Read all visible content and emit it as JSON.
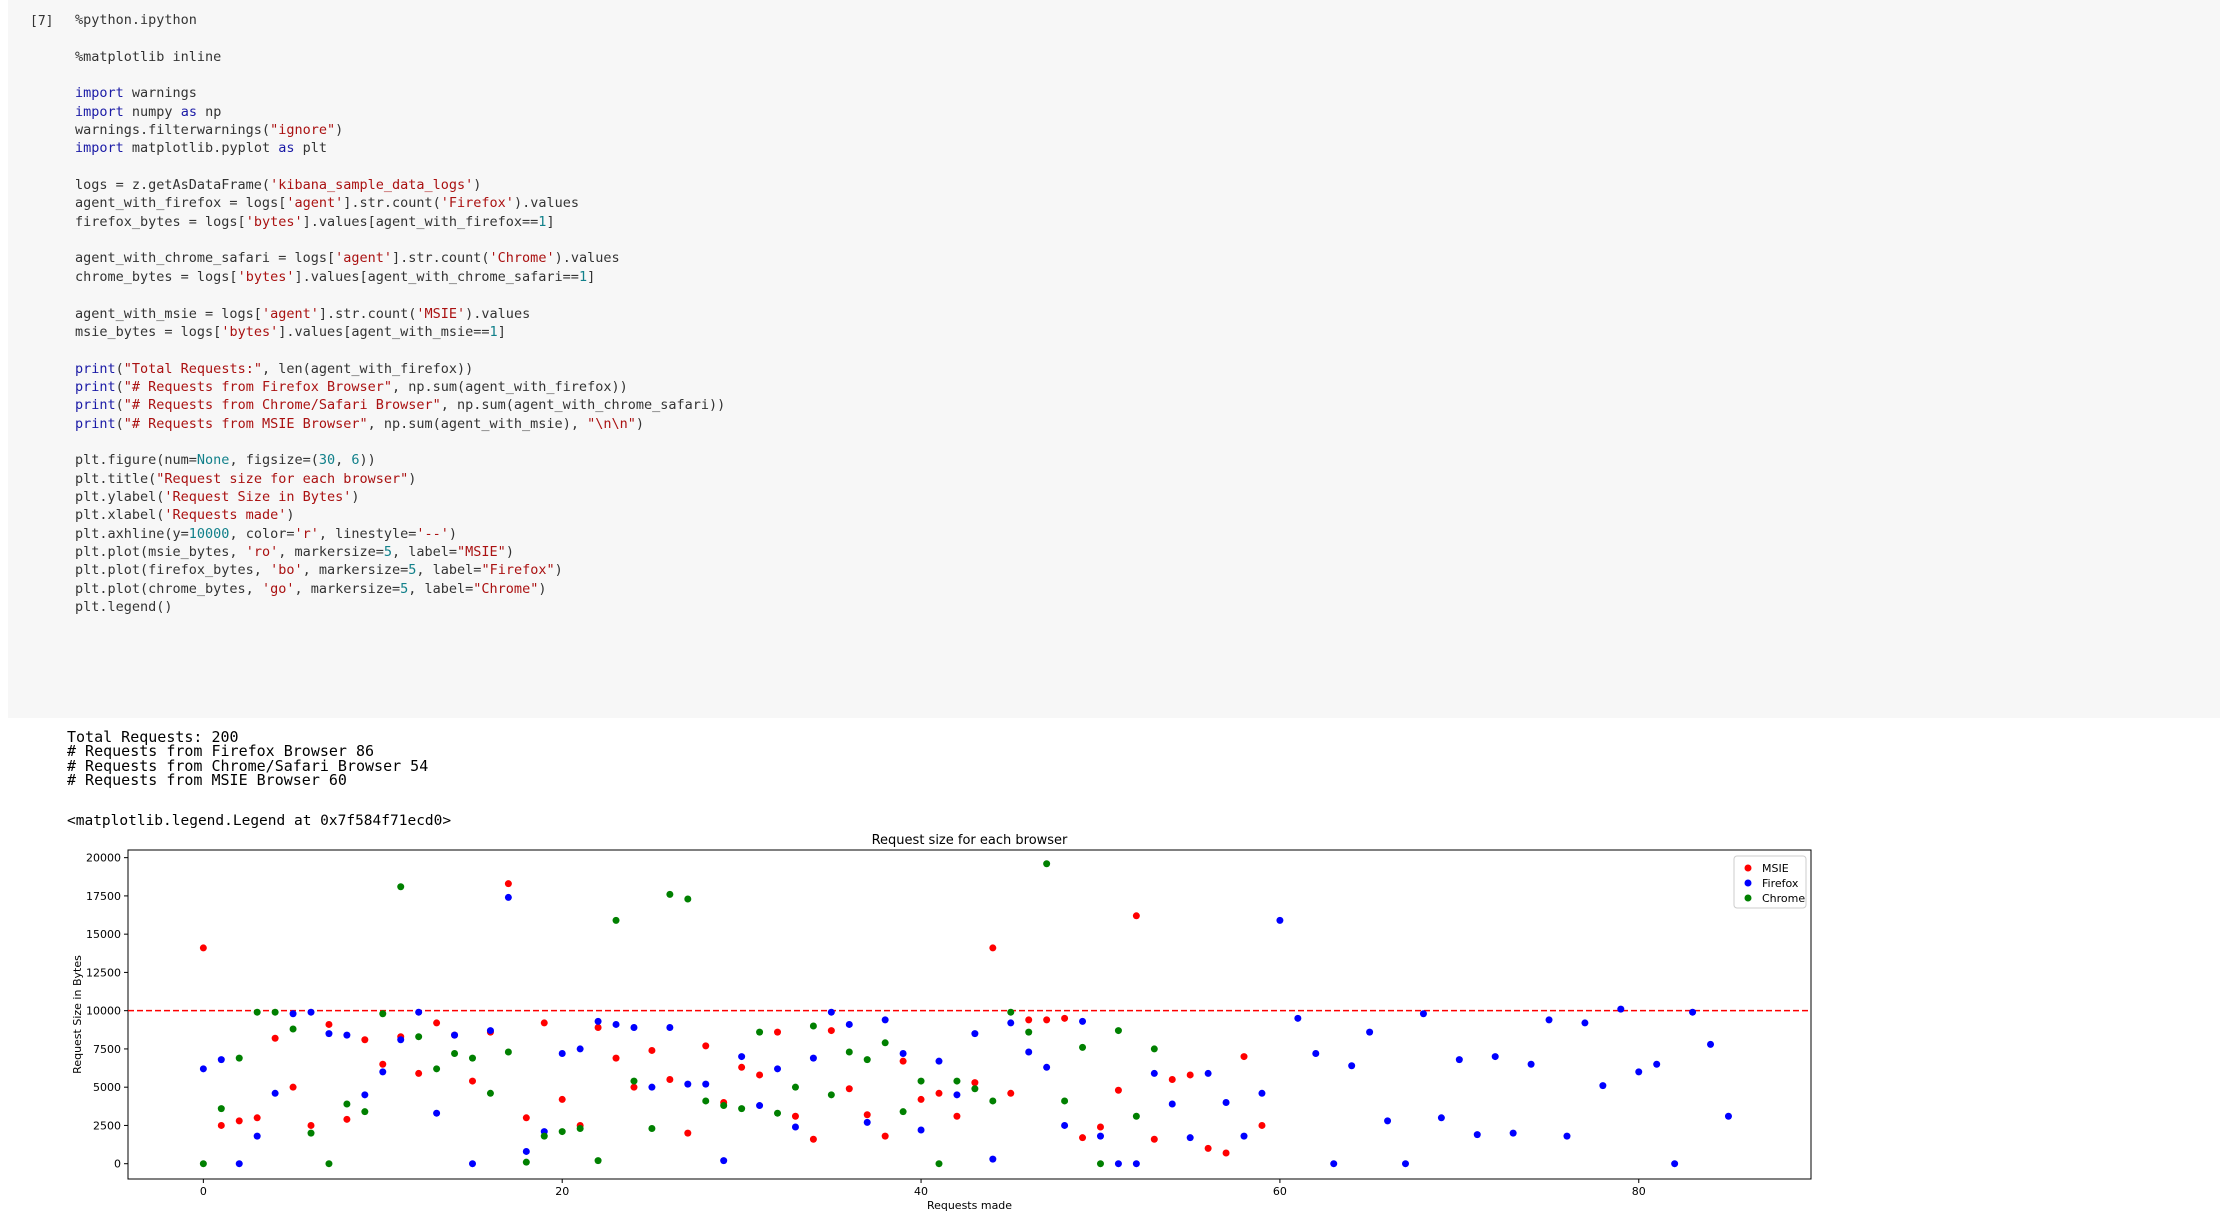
{
  "cell": {
    "prompt": "[7]",
    "code_lines": [
      [
        {
          "t": "%python.ipython",
          "c": ""
        }
      ],
      [],
      [
        {
          "t": "%matplotlib inline",
          "c": ""
        }
      ],
      [],
      [
        {
          "t": "import",
          "c": "kw"
        },
        {
          "t": " warnings",
          "c": ""
        }
      ],
      [
        {
          "t": "import",
          "c": "kw"
        },
        {
          "t": " numpy ",
          "c": ""
        },
        {
          "t": "as",
          "c": "kw"
        },
        {
          "t": " np",
          "c": ""
        }
      ],
      [
        {
          "t": "warnings.filterwarnings(",
          "c": ""
        },
        {
          "t": "\"ignore\"",
          "c": "str"
        },
        {
          "t": ")",
          "c": ""
        }
      ],
      [
        {
          "t": "import",
          "c": "kw"
        },
        {
          "t": " matplotlib.pyplot ",
          "c": ""
        },
        {
          "t": "as",
          "c": "kw"
        },
        {
          "t": " plt",
          "c": ""
        }
      ],
      [],
      [
        {
          "t": "logs = z.getAsDataFrame(",
          "c": ""
        },
        {
          "t": "'kibana_sample_data_logs'",
          "c": "str"
        },
        {
          "t": ")",
          "c": ""
        }
      ],
      [
        {
          "t": "agent_with_firefox = logs[",
          "c": ""
        },
        {
          "t": "'agent'",
          "c": "str"
        },
        {
          "t": "].str.count(",
          "c": ""
        },
        {
          "t": "'Firefox'",
          "c": "str"
        },
        {
          "t": ").values",
          "c": ""
        }
      ],
      [
        {
          "t": "firefox_bytes = logs[",
          "c": ""
        },
        {
          "t": "'bytes'",
          "c": "str"
        },
        {
          "t": "].values[agent_with_firefox==",
          "c": ""
        },
        {
          "t": "1",
          "c": "num"
        },
        {
          "t": "]",
          "c": ""
        }
      ],
      [],
      [
        {
          "t": "agent_with_chrome_safari = logs[",
          "c": ""
        },
        {
          "t": "'agent'",
          "c": "str"
        },
        {
          "t": "].str.count(",
          "c": ""
        },
        {
          "t": "'Chrome'",
          "c": "str"
        },
        {
          "t": ").values",
          "c": ""
        }
      ],
      [
        {
          "t": "chrome_bytes = logs[",
          "c": ""
        },
        {
          "t": "'bytes'",
          "c": "str"
        },
        {
          "t": "].values[agent_with_chrome_safari==",
          "c": ""
        },
        {
          "t": "1",
          "c": "num"
        },
        {
          "t": "]",
          "c": ""
        }
      ],
      [],
      [
        {
          "t": "agent_with_msie = logs[",
          "c": ""
        },
        {
          "t": "'agent'",
          "c": "str"
        },
        {
          "t": "].str.count(",
          "c": ""
        },
        {
          "t": "'MSIE'",
          "c": "str"
        },
        {
          "t": ").values",
          "c": ""
        }
      ],
      [
        {
          "t": "msie_bytes = logs[",
          "c": ""
        },
        {
          "t": "'bytes'",
          "c": "str"
        },
        {
          "t": "].values[agent_with_msie==",
          "c": ""
        },
        {
          "t": "1",
          "c": "num"
        },
        {
          "t": "]",
          "c": ""
        }
      ],
      [],
      [
        {
          "t": "print",
          "c": "kw"
        },
        {
          "t": "(",
          "c": ""
        },
        {
          "t": "\"Total Requests:\"",
          "c": "str"
        },
        {
          "t": ", len(agent_with_firefox))",
          "c": ""
        }
      ],
      [
        {
          "t": "print",
          "c": "kw"
        },
        {
          "t": "(",
          "c": ""
        },
        {
          "t": "\"# Requests from Firefox Browser\"",
          "c": "str"
        },
        {
          "t": ", np.sum(agent_with_firefox))",
          "c": ""
        }
      ],
      [
        {
          "t": "print",
          "c": "kw"
        },
        {
          "t": "(",
          "c": ""
        },
        {
          "t": "\"# Requests from Chrome/Safari Browser\"",
          "c": "str"
        },
        {
          "t": ", np.sum(agent_with_chrome_safari))",
          "c": ""
        }
      ],
      [
        {
          "t": "print",
          "c": "kw"
        },
        {
          "t": "(",
          "c": ""
        },
        {
          "t": "\"# Requests from MSIE Browser\"",
          "c": "str"
        },
        {
          "t": ", np.sum(agent_with_msie), ",
          "c": ""
        },
        {
          "t": "\"\\n\\n\"",
          "c": "str"
        },
        {
          "t": ")",
          "c": ""
        }
      ],
      [],
      [
        {
          "t": "plt.figure(num=",
          "c": ""
        },
        {
          "t": "None",
          "c": "num"
        },
        {
          "t": ", figsize=(",
          "c": ""
        },
        {
          "t": "30",
          "c": "num"
        },
        {
          "t": ", ",
          "c": ""
        },
        {
          "t": "6",
          "c": "num"
        },
        {
          "t": "))",
          "c": ""
        }
      ],
      [
        {
          "t": "plt.title(",
          "c": ""
        },
        {
          "t": "\"Request size for each browser\"",
          "c": "str"
        },
        {
          "t": ")",
          "c": ""
        }
      ],
      [
        {
          "t": "plt.ylabel(",
          "c": ""
        },
        {
          "t": "'Request Size in Bytes'",
          "c": "str"
        },
        {
          "t": ")",
          "c": ""
        }
      ],
      [
        {
          "t": "plt.xlabel(",
          "c": ""
        },
        {
          "t": "'Requests made'",
          "c": "str"
        },
        {
          "t": ")",
          "c": ""
        }
      ],
      [
        {
          "t": "plt.axhline(y=",
          "c": ""
        },
        {
          "t": "10000",
          "c": "num"
        },
        {
          "t": ", color=",
          "c": ""
        },
        {
          "t": "'r'",
          "c": "str"
        },
        {
          "t": ", linestyle=",
          "c": ""
        },
        {
          "t": "'--'",
          "c": "str"
        },
        {
          "t": ")",
          "c": ""
        }
      ],
      [
        {
          "t": "plt.plot(msie_bytes, ",
          "c": ""
        },
        {
          "t": "'ro'",
          "c": "str"
        },
        {
          "t": ", markersize=",
          "c": ""
        },
        {
          "t": "5",
          "c": "num"
        },
        {
          "t": ", label=",
          "c": ""
        },
        {
          "t": "\"MSIE\"",
          "c": "str"
        },
        {
          "t": ")",
          "c": ""
        }
      ],
      [
        {
          "t": "plt.plot(firefox_bytes, ",
          "c": ""
        },
        {
          "t": "'bo'",
          "c": "str"
        },
        {
          "t": ", markersize=",
          "c": ""
        },
        {
          "t": "5",
          "c": "num"
        },
        {
          "t": ", label=",
          "c": ""
        },
        {
          "t": "\"Firefox\"",
          "c": "str"
        },
        {
          "t": ")",
          "c": ""
        }
      ],
      [
        {
          "t": "plt.plot(chrome_bytes, ",
          "c": ""
        },
        {
          "t": "'go'",
          "c": "str"
        },
        {
          "t": ", markersize=",
          "c": ""
        },
        {
          "t": "5",
          "c": "num"
        },
        {
          "t": ", label=",
          "c": ""
        },
        {
          "t": "\"Chrome\"",
          "c": "str"
        },
        {
          "t": ")",
          "c": ""
        }
      ],
      [
        {
          "t": "plt.legend()",
          "c": ""
        }
      ]
    ]
  },
  "output": {
    "text_lines": [
      "Total Requests: 200",
      "# Requests from Firefox Browser 86",
      "# Requests from Chrome/Safari Browser 54",
      "# Requests from MSIE Browser 60"
    ],
    "repr": "<matplotlib.legend.Legend at 0x7f584f71ecd0>"
  },
  "chart_data": {
    "type": "scatter",
    "title": "Request size for each browser",
    "xlabel": "Requests made",
    "ylabel": "Request Size in Bytes",
    "xlim": [
      -4.2,
      89.6
    ],
    "ylim": [
      -1000,
      20500
    ],
    "xticks": [
      0,
      20,
      40,
      60,
      80
    ],
    "yticks": [
      0,
      2500,
      5000,
      7500,
      10000,
      12500,
      15000,
      17500,
      20000
    ],
    "axhline": {
      "y": 10000,
      "color": "#ff0000",
      "style": "dashed"
    },
    "grid": false,
    "legend_position": "upper right",
    "series": [
      {
        "name": "MSIE",
        "color": "#ff0000",
        "values": [
          14100,
          2500,
          2800,
          3000,
          8200,
          5000,
          2500,
          9100,
          2900,
          8100,
          6500,
          8300,
          5900,
          9200,
          8400,
          5400,
          8600,
          18300,
          3000,
          9200,
          4200,
          2500,
          8900,
          6900,
          5000,
          7400,
          5500,
          2000,
          7700,
          4000,
          6300,
          5800,
          8600,
          3100,
          1600,
          8700,
          4900,
          3200,
          1800,
          6700,
          4200,
          4600,
          3100,
          5300,
          14100,
          4600,
          9400,
          9400,
          9500,
          1700,
          2400,
          4800,
          16200,
          1600,
          5500,
          5800,
          1000,
          700,
          7000,
          2500
        ]
      },
      {
        "name": "Firefox",
        "color": "#0000ff",
        "values": [
          6200,
          6800,
          0,
          1800,
          4600,
          9800,
          9900,
          8500,
          8400,
          4500,
          6000,
          8100,
          9900,
          3300,
          8400,
          0,
          8700,
          17400,
          800,
          2100,
          7200,
          7500,
          9300,
          9100,
          8900,
          5000,
          8900,
          5200,
          5200,
          200,
          7000,
          3800,
          6200,
          2400,
          6900,
          9900,
          9100,
          2700,
          9400,
          7200,
          2200,
          6700,
          4500,
          8500,
          300,
          9200,
          7300,
          6300,
          2500,
          9300,
          1800,
          0,
          0,
          5900,
          3900,
          1700,
          5900,
          4000,
          1800,
          4600,
          15900,
          9500,
          7200,
          0,
          6400,
          8600,
          2800,
          0,
          9800,
          3000,
          6800,
          1900,
          7000,
          2000,
          6500,
          9400,
          1800,
          9200,
          5100,
          10100,
          6000,
          6500,
          0,
          9900,
          7800,
          3100
        ]
      },
      {
        "name": "Chrome",
        "color": "#008000",
        "values": [
          0,
          3600,
          6900,
          9900,
          9900,
          8800,
          2000,
          0,
          3900,
          3400,
          9800,
          18100,
          8300,
          6200,
          7200,
          6900,
          4600,
          7300,
          100,
          1800,
          2100,
          2300,
          200,
          15900,
          5400,
          2300,
          17600,
          17300,
          4100,
          3800,
          3600,
          8600,
          3300,
          5000,
          9000,
          4500,
          7300,
          6800,
          7900,
          3400,
          5400,
          0,
          5400,
          4900,
          4100,
          9900,
          8600,
          19600,
          4100,
          7600,
          0,
          8700,
          3100,
          7500
        ]
      }
    ]
  }
}
